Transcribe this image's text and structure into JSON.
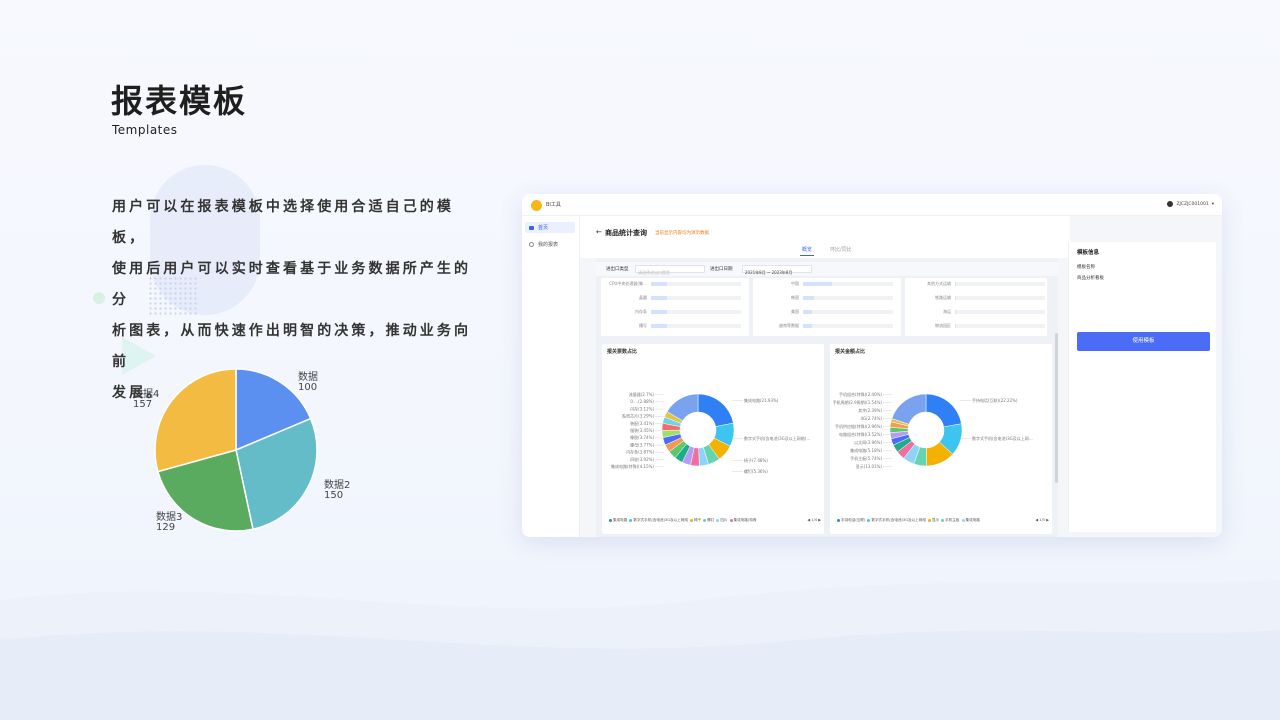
{
  "header": {
    "title": "报表模板",
    "subtitle": "Templates"
  },
  "description": [
    "用户可以在报表模板中选择使用合适自己的模板，",
    "使用后用户可以实时查看基于业务数据所产生的分",
    "析图表，从而快速作出明智的决策，推动业务向前",
    "发展。"
  ],
  "chart_data": {
    "type": "pie",
    "categories": [
      "数据",
      "数据2",
      "数据3",
      "数据4"
    ],
    "values": [
      100,
      150,
      129,
      157
    ],
    "colors": [
      "#5b8ff0",
      "#63bcc8",
      "#5aab5f",
      "#f4bb42"
    ]
  },
  "app": {
    "app_name": "BI工具",
    "user": "ZJCZJC001001",
    "nav": [
      {
        "label": "首页"
      },
      {
        "label": "我的报表"
      }
    ],
    "page_title": "商品统计查询",
    "page_note": "当前显示内容均为演示数据",
    "tabs": [
      "概览",
      "环比/同比"
    ],
    "filter": {
      "type_label": "进出口类型",
      "type_placeholder": "请选择进出口类型",
      "date_label": "进出口日期",
      "date_value": "2021年8月 ~ 2023年8月"
    },
    "mini_charts": [
      {
        "rows": [
          {
            "label": "CPU中央处理器(集…",
            "v": 0.18
          },
          {
            "label": "晶圆",
            "v": 0.18
          },
          {
            "label": "内存条",
            "v": 0.18
          },
          {
            "label": "槽号",
            "v": 0.18
          }
        ]
      },
      {
        "rows": [
          {
            "label": "中国",
            "v": 0.32
          },
          {
            "label": "韩国",
            "v": 0.12
          },
          {
            "label": "美国",
            "v": 0.1
          },
          {
            "label": "越南等数据",
            "v": 0.1
          }
        ]
      },
      {
        "rows": [
          {
            "label": "其他方式运输",
            "v": 0.01
          },
          {
            "label": "铁路运输",
            "v": 0.01
          },
          {
            "label": "海运",
            "v": 0.01
          },
          {
            "label": "物流园区",
            "v": 0.01
          }
        ]
      }
    ],
    "panels": [
      {
        "title": "报关票数占比",
        "labels_left": [
          "流量器(2.7%)",
          "0.…(2.88%)",
          "闪存(3.12%)",
          "贴纸芯片(3.29%)",
          "装配(3.41%)",
          "服装(3.45%)",
          "橡胶(3.74%)",
          "螺母(3.77%)",
          "内存条(3.87%)",
          "四轮(3.92%)",
          "集成电路(特殊)(4.15%)"
        ],
        "labels_right": [
          "集成电路(21.93%)",
          "数字式手机(含电池)3G及以上网络(…",
          "椅子(7.48%)",
          "螺钉(5.36%)"
        ],
        "slices": [
          {
            "v": 21.93,
            "c": "#2f7ff5"
          },
          {
            "v": 10.5,
            "c": "#3ec4f0"
          },
          {
            "v": 7.48,
            "c": "#f3b100"
          },
          {
            "v": 5.36,
            "c": "#64d5b0"
          },
          {
            "v": 4.15,
            "c": "#8ed3fb"
          },
          {
            "v": 3.92,
            "c": "#f06f9c"
          },
          {
            "v": 3.87,
            "c": "#b79cf5"
          },
          {
            "v": 3.77,
            "c": "#1cae8a"
          },
          {
            "v": 3.74,
            "c": "#5dc86a"
          },
          {
            "v": 3.45,
            "c": "#f49a54"
          },
          {
            "v": 3.41,
            "c": "#4a6cf7"
          },
          {
            "v": 3.29,
            "c": "#a0e06a"
          },
          {
            "v": 3.12,
            "c": "#f56b6b"
          },
          {
            "v": 2.88,
            "c": "#6fd3e8"
          },
          {
            "v": 2.7,
            "c": "#e3c44b"
          },
          {
            "v": 16.43,
            "c": "#7aa3ef"
          }
        ],
        "legend": [
          {
            "t": "集成电路",
            "c": "#2f7ff5"
          },
          {
            "t": "数字式手机(含电池)3G及以上网络",
            "c": "#3ec4f0"
          },
          {
            "t": "椅子",
            "c": "#f3b100"
          },
          {
            "t": "螺钉",
            "c": "#64d5b0"
          },
          {
            "t": "四片",
            "c": "#8ed3fb"
          },
          {
            "t": "集成电路(特殊",
            "c": "#f06f9c"
          }
        ],
        "page": "1/4"
      },
      {
        "title": "报关金额占比",
        "labels_left": [
          "手机组合(特殊)(2.40%)",
          "手机周期(2.9周期)(1.54%)",
          "其余(2.39%)",
          "4G(2.74%)",
          "手机供应链(特殊)(2.96%)",
          "电路组合(特殊)(3.52%)",
          "以太网(3.96%)",
          "集成电路(5.18%)",
          "手机主板(5.74%)",
          "显示(13.01%)"
        ],
        "labels_right": [
          "手持电话(互联)(22.22%)",
          "数字式手机(含电池)3G及以上网…"
        ],
        "slices": [
          {
            "v": 22.22,
            "c": "#2f7ff5"
          },
          {
            "v": 14.5,
            "c": "#3ec4f0"
          },
          {
            "v": 13.01,
            "c": "#f3b100"
          },
          {
            "v": 5.74,
            "c": "#64d5b0"
          },
          {
            "v": 5.18,
            "c": "#8ed3fb"
          },
          {
            "v": 3.96,
            "c": "#f06f9c"
          },
          {
            "v": 3.52,
            "c": "#1cae8a"
          },
          {
            "v": 2.96,
            "c": "#4a6cf7"
          },
          {
            "v": 2.74,
            "c": "#b79cf5"
          },
          {
            "v": 2.39,
            "c": "#5dc86a"
          },
          {
            "v": 2.4,
            "c": "#f49a54"
          },
          {
            "v": 1.54,
            "c": "#e3c44b"
          },
          {
            "v": 19.84,
            "c": "#7aa3ef"
          }
        ],
        "legend": [
          {
            "t": "手持电话(互联)",
            "c": "#2f7ff5"
          },
          {
            "t": "数字式手机(含电池)3G及以上网络",
            "c": "#3ec4f0"
          },
          {
            "t": "显示",
            "c": "#f3b100"
          },
          {
            "t": "手机主板",
            "c": "#64d5b0"
          },
          {
            "t": "集成电路",
            "c": "#8ed3fb"
          }
        ],
        "page": "1/5"
      }
    ],
    "info": {
      "title": "模板信息",
      "name_label": "模板名称",
      "name_value": "商品分析看板",
      "button": "使用模板"
    }
  }
}
